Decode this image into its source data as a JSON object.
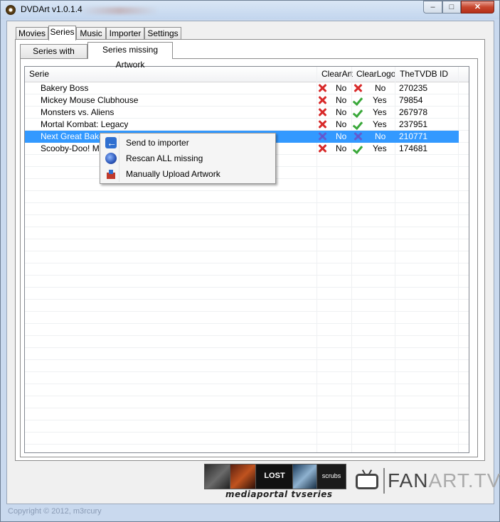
{
  "window": {
    "title": "DVDArt v1.0.1.4",
    "controls": {
      "minimize": "–",
      "maximize": "□",
      "close": "✕"
    }
  },
  "outer_tabs": [
    "Movies",
    "Series",
    "Music",
    "Importer",
    "Settings"
  ],
  "outer_tab_active": "Series",
  "inner_tabs": [
    "Series with Artwork",
    "Series missing Artwork"
  ],
  "inner_tab_active": "Series missing Artwork",
  "grid": {
    "columns": [
      "Serie",
      "ClearArt",
      "ClearLogo",
      "TheTVDB ID"
    ],
    "rows": [
      {
        "serie": "Bakery Boss",
        "clearart": "No",
        "clearart_icon": "red-x-icon",
        "clearlogo": "No",
        "clearlogo_icon": "red-x-icon",
        "tvdb": "270235"
      },
      {
        "serie": "Mickey Mouse Clubhouse",
        "clearart": "No",
        "clearart_icon": "red-x-icon",
        "clearlogo": "Yes",
        "clearlogo_icon": "green-check-icon",
        "tvdb": "79854"
      },
      {
        "serie": "Monsters vs. Aliens",
        "clearart": "No",
        "clearart_icon": "red-x-icon",
        "clearlogo": "Yes",
        "clearlogo_icon": "green-check-icon",
        "tvdb": "267978"
      },
      {
        "serie": "Mortal Kombat: Legacy",
        "clearart": "No",
        "clearart_icon": "red-x-icon",
        "clearlogo": "Yes",
        "clearlogo_icon": "green-check-icon",
        "tvdb": "237951"
      },
      {
        "serie": "Next Great Bake",
        "clearart": "No",
        "clearart_icon": "red-x-icon",
        "clearlogo": "No",
        "clearlogo_icon": "red-x-icon",
        "tvdb": "210771",
        "selected": true
      },
      {
        "serie": "Scooby-Doo! My",
        "clearart": "No",
        "clearart_icon": "red-x-icon",
        "clearlogo": "Yes",
        "clearlogo_icon": "green-check-icon",
        "tvdb": "174681"
      }
    ]
  },
  "context_menu": {
    "items": [
      {
        "label": "Send to importer",
        "icon": "import-arrow-icon"
      },
      {
        "label": "Rescan ALL missing",
        "icon": "rescan-globe-icon"
      },
      {
        "label": "Manually Upload Artwork",
        "icon": "upload-icon"
      }
    ]
  },
  "footer": {
    "mediaportal_text": "mediaportal tvseries",
    "mp_screen_text": "LOST",
    "mp_screen_text2": "scrubs",
    "fanart_text_dark": "FAN",
    "fanart_text_light": "ART.TV",
    "copyright": "Copyright © 2012, m3rcury"
  },
  "colors": {
    "selection": "#3399ff",
    "window_frame": "#c9d9ee",
    "close_button": "#c7462d"
  }
}
